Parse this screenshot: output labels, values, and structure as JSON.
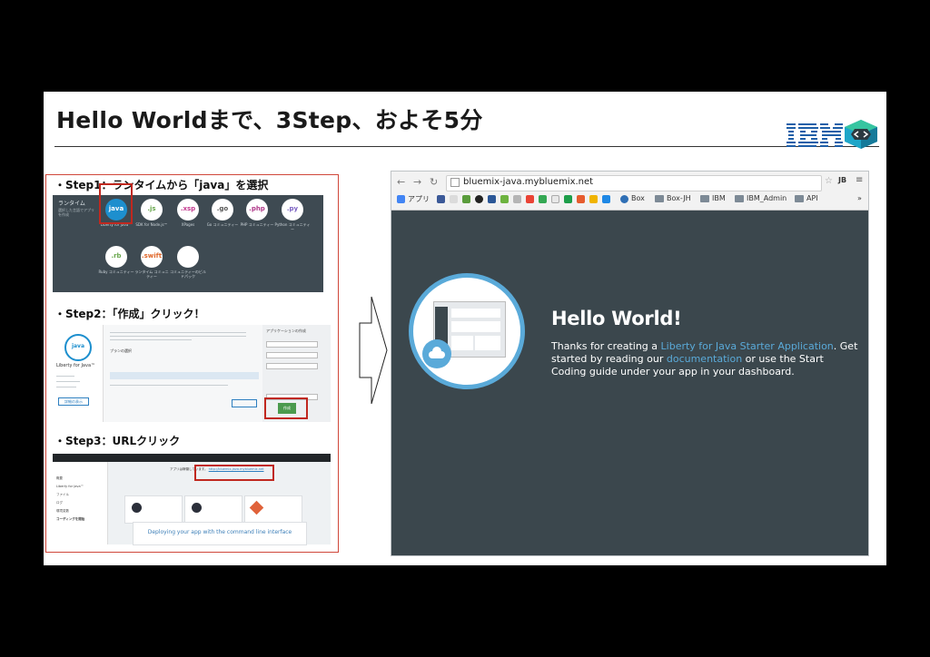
{
  "slide": {
    "title": "Hello Worldまで、3Step、およそ5分",
    "logo_text": "IBM"
  },
  "colors": {
    "accent_red": "#c0281f",
    "bluemix_blue": "#5aaad9",
    "dark_bg": "#3b474d"
  },
  "step1": {
    "label": "・Step1：ランタイムから「java」を選択",
    "heading": "ランタイム",
    "subtext": "選択した言語でアプリを作成",
    "runtimes": [
      {
        "badge": "java",
        "caption": "Liberty for Java™"
      },
      {
        "badge": ".js",
        "caption": "SDK for Node.js™"
      },
      {
        "badge": ".xsp",
        "caption": "XPages"
      },
      {
        "badge": ".go",
        "caption": "Go コミュニティー"
      },
      {
        "badge": ".php",
        "caption": "PHP コミュニティー"
      },
      {
        "badge": ".py",
        "caption": "Python コミュニティー"
      },
      {
        "badge": ".rb",
        "caption": "Ruby コミュニティー"
      },
      {
        "badge": ".swift",
        "caption": "ランタイム コミュニティー"
      },
      {
        "badge": "",
        "caption": "コミュニティーのビルドパック"
      }
    ]
  },
  "step2": {
    "label": "・Step2：「作成」クリック！",
    "badge": "java",
    "app_name": "Liberty for Java™",
    "pricing": "プランの選択",
    "more_button": "詳細の表示",
    "side_title": "アプリケーションの作成",
    "create_button": "作成"
  },
  "step3": {
    "label": "・Step3：URLクリック",
    "status": "アプリは稼働しています。",
    "url": "http://bluemix-java.mybluemix.net",
    "deploy_text": "Deploying your app with the command line interface",
    "side_items": [
      "概要",
      "Liberty for Java™",
      "ファイル",
      "ログ",
      "環境変数",
      "コーディングを開始"
    ]
  },
  "browser": {
    "url": "bluemix-java.mybluemix.net",
    "bookmarks": {
      "apps": "アプリ",
      "box": "Box",
      "box_jh": "Box-JH",
      "ibm": "IBM",
      "ibm_admin": "IBM_Admin",
      "api": "API",
      "more": "»"
    },
    "hello_title": "Hello World!",
    "body_pre": "Thanks for creating a ",
    "link1": "Liberty for Java Starter Application",
    "body_mid": ". Get started by reading our ",
    "link2": "documentation",
    "body_post": " or use the Start Coding guide under your app in your dashboard."
  }
}
